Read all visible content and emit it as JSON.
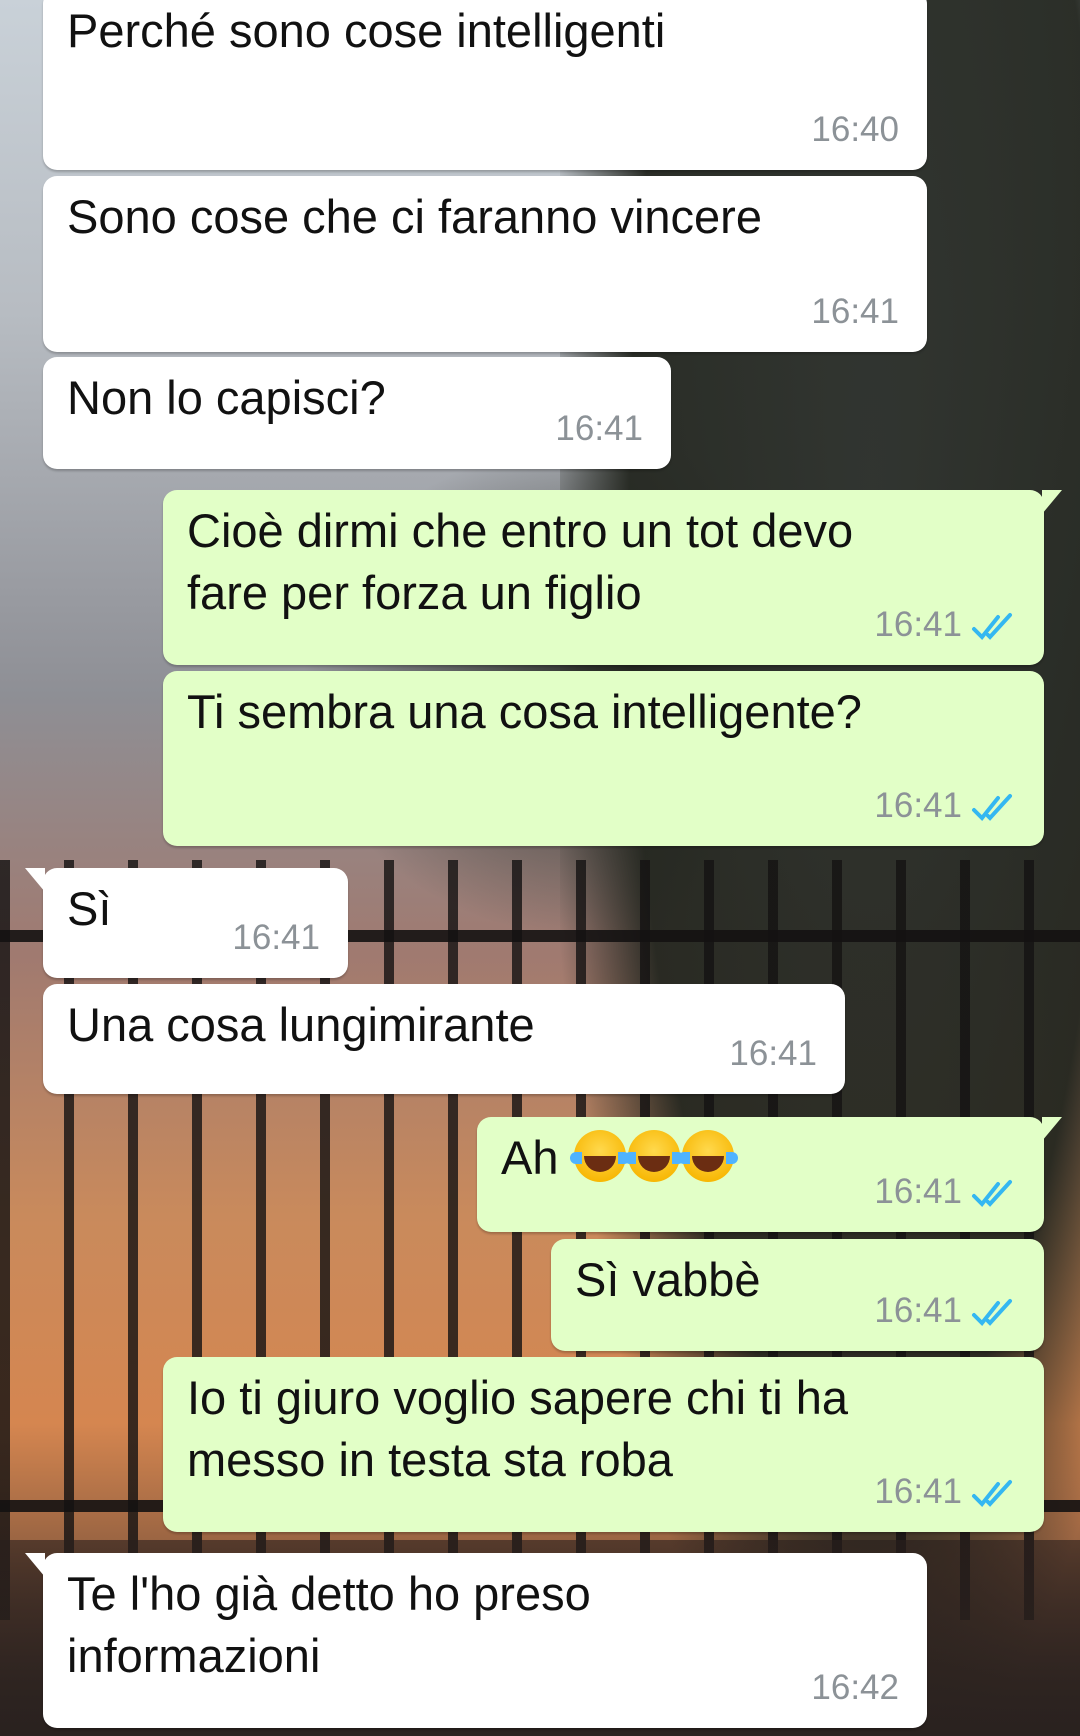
{
  "messages": [
    {
      "dir": "in",
      "text": "Perché sono cose intelligenti",
      "time": "16:40"
    },
    {
      "dir": "in",
      "text": "Sono cose che ci faranno vincere",
      "time": "16:41"
    },
    {
      "dir": "in",
      "text": "Non lo capisci?",
      "time": "16:41"
    },
    {
      "dir": "out",
      "text": "Cioè dirmi che entro un tot devo\nfare per forza un figlio",
      "time": "16:41",
      "status": "read"
    },
    {
      "dir": "out",
      "text": "Ti sembra una cosa intelligente?",
      "time": "16:41",
      "status": "read"
    },
    {
      "dir": "in",
      "text": "Sì",
      "time": "16:41"
    },
    {
      "dir": "in",
      "text": "Una cosa lungimirante",
      "time": "16:41"
    },
    {
      "dir": "out",
      "text": "Ah",
      "emoji": [
        "face-with-tears-of-joy-icon",
        "face-with-tears-of-joy-icon",
        "face-with-tears-of-joy-icon"
      ],
      "time": "16:41",
      "status": "read"
    },
    {
      "dir": "out",
      "text": "Sì vabbè",
      "time": "16:41",
      "status": "read"
    },
    {
      "dir": "out",
      "text": "Io ti giuro voglio sapere chi ti ha\nmesso in testa sta roba",
      "time": "16:41",
      "status": "read"
    },
    {
      "dir": "in",
      "text": "Te l'ho già detto ho preso\ninformazioni",
      "time": "16:42"
    }
  ],
  "colors": {
    "incoming_bubble": "#ffffff",
    "outgoing_bubble": "#e2ffc7",
    "timestamp": "#8c9297",
    "read_ticks": "#34b7f1"
  }
}
